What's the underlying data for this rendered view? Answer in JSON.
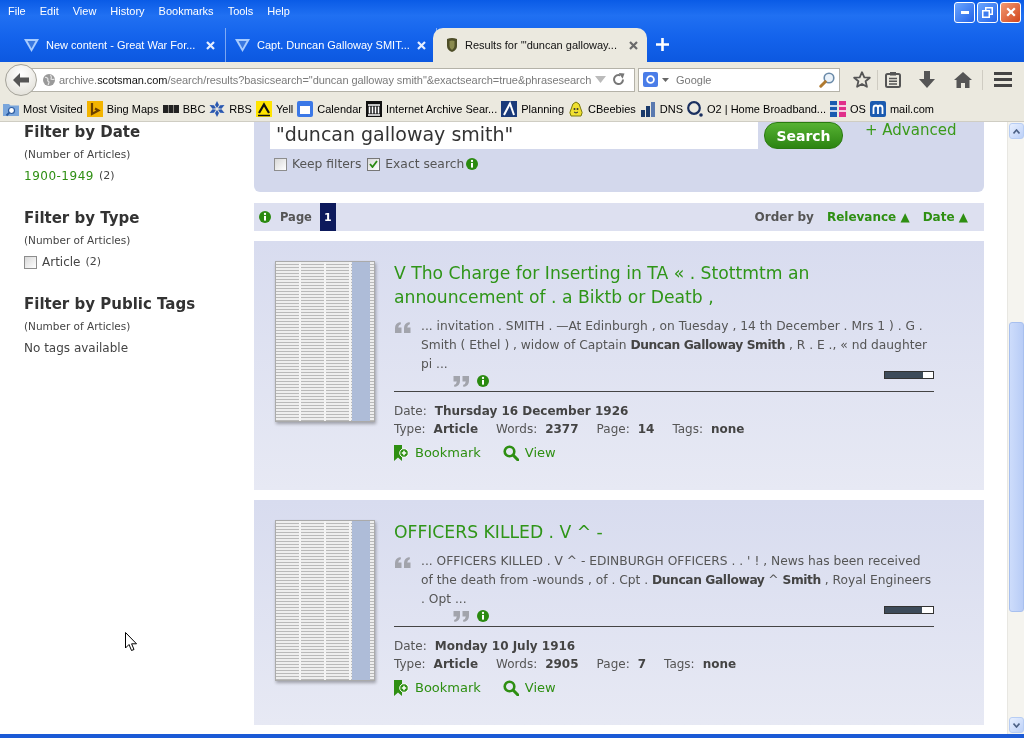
{
  "menu": [
    "File",
    "Edit",
    "View",
    "History",
    "Bookmarks",
    "Tools",
    "Help"
  ],
  "tabs": [
    {
      "title": "New content - Great War For...",
      "selected": false
    },
    {
      "title": "Capt. Duncan Galloway SMIT...",
      "selected": false
    },
    {
      "title": "Results for '\"duncan galloway...",
      "selected": true
    }
  ],
  "address_bar": {
    "url_start": "archive.",
    "url_domain": "scotsman.com",
    "url_end": "/search/results?basicsearch=\"duncan galloway smith\"&exactsearch=true&phrasesearch"
  },
  "search_bar": {
    "placeholder": "Google"
  },
  "bookmarks": [
    "Most Visited",
    "Bing Maps",
    "BBC",
    "RBS",
    "Yell",
    "Calendar",
    "Internet Archive Sear...",
    "Planning",
    "CBeebies",
    "DNS",
    "O2 | Home Broadband...",
    "OS",
    "mail.com"
  ],
  "sidebar": {
    "filters": [
      {
        "title": "Filter by Date",
        "note": "(Number of Articles)",
        "items": [
          {
            "kind": "link",
            "label": "1900-1949",
            "count": "(2)"
          }
        ]
      },
      {
        "title": "Filter by Type",
        "note": "(Number of Articles)",
        "items": [
          {
            "kind": "checkbox",
            "label": "Article",
            "count": "(2)",
            "checked": false
          }
        ]
      },
      {
        "title": "Filter by Public Tags",
        "note": "(Number of Articles)",
        "items": [
          {
            "kind": "text",
            "label": "No tags available"
          }
        ]
      }
    ]
  },
  "search": {
    "query": "\"duncan galloway smith\"",
    "button": "Search",
    "advanced": "+ Advanced",
    "options": [
      {
        "label": "Keep filters",
        "checked": false,
        "info": false
      },
      {
        "label": "Exact search",
        "checked": true,
        "info": true
      }
    ]
  },
  "pager": {
    "label": "Page",
    "pages": [
      {
        "label": "1",
        "selected": true
      }
    ],
    "order_label": "Order by",
    "sort": [
      {
        "label": "Relevance ▲"
      },
      {
        "label": "Date ▲"
      }
    ]
  },
  "results": [
    {
      "title": "V Tho Charge for Inserting in TA « . Stottmtm an announcement of . a Biktb or Deatb ,",
      "snippet": "... invitation . SMITH . —At Edinburgh , on Tuesday , 14 th December . Mrs 1 ) . G . Smith ( Ethel ) , widow of Captain **Duncan Galloway Smith** , R . E ., « nd daughter pi ...",
      "level": 0.8,
      "meta": [
        [
          {
            "label": "Date:",
            "value": "Thursday 16 December 1926"
          }
        ],
        [
          {
            "label": "Type:",
            "value": "Article"
          },
          {
            "label": "Words:",
            "value": "2377"
          },
          {
            "label": "Page:",
            "value": "14"
          },
          {
            "label": "Tags:",
            "value": "none"
          }
        ]
      ],
      "actions": [
        {
          "kind": "bookmark",
          "label": "Bookmark"
        },
        {
          "kind": "view",
          "label": "View"
        }
      ]
    },
    {
      "title": "OFFICERS KILLED . V ^ -",
      "snippet": "... OFFICERS KILLED . V ^ - EDINBURGH OFFICERS . . ' ! , News has been received of the death from -wounds , of . Cpt . **Duncan Galloway** ^ **Smith** , Royal Engineers . Opt ...",
      "level": 0.78,
      "meta": [
        [
          {
            "label": "Date:",
            "value": "Monday 10 July 1916"
          }
        ],
        [
          {
            "label": "Type:",
            "value": "Article"
          },
          {
            "label": "Words:",
            "value": "2905"
          },
          {
            "label": "Page:",
            "value": "7"
          },
          {
            "label": "Tags:",
            "value": "none"
          }
        ]
      ],
      "actions": [
        {
          "kind": "bookmark",
          "label": "Bookmark"
        },
        {
          "kind": "view",
          "label": "View"
        }
      ]
    }
  ]
}
